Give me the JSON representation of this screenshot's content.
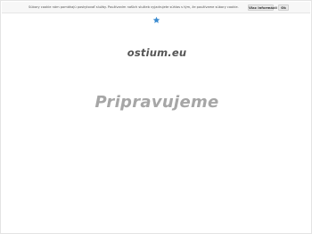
{
  "cookie_bar": {
    "message": "Súbory cookie nám pomáhajú poskytovať služby. Používaním našich služieb vyjadrujete súhlas s tým, že používame súbory cookie.",
    "more_info_label": "Viac informácií",
    "ok_label": "Ok"
  },
  "header": {
    "star_icon": "star-icon",
    "star_color": "#3a8bd0"
  },
  "main": {
    "domain": "ostium.eu",
    "status_text": "Pripravujeme"
  }
}
